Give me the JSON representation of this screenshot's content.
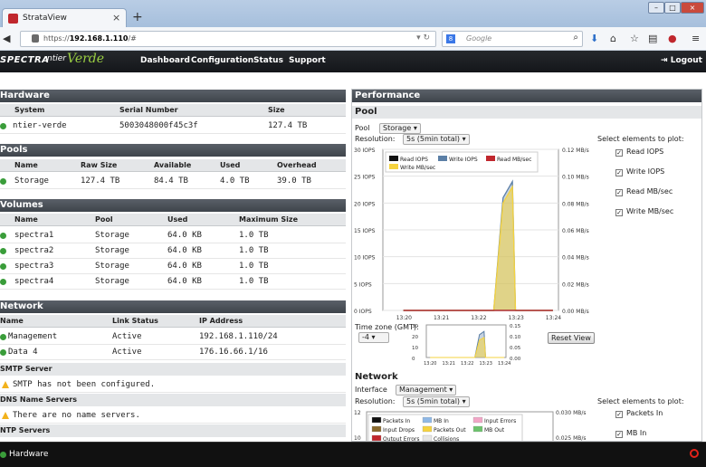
{
  "browser": {
    "tab_title": "StrataView",
    "url_prefix": "https://",
    "url_host": "192.168.1.110",
    "url_path": "/#",
    "search_placeholder": "Google"
  },
  "app": {
    "logo_text": "SPECTRA",
    "logo_sub": "ntier",
    "logo_brand": "Verde",
    "menu": [
      "Dashboard",
      "Configuration",
      "Status",
      "Support"
    ],
    "logout": "Logout"
  },
  "hardware": {
    "title": "Hardware",
    "columns": [
      "System",
      "Serial Number",
      "Size"
    ],
    "rows": [
      [
        "ntier-verde",
        "5003048000f45c3f",
        "127.4 TB"
      ]
    ]
  },
  "pools": {
    "title": "Pools",
    "columns": [
      "Name",
      "Raw Size",
      "Available",
      "Used",
      "Overhead"
    ],
    "rows": [
      [
        "Storage",
        "127.4 TB",
        "84.4 TB",
        "4.0 TB",
        "39.0 TB"
      ]
    ]
  },
  "volumes": {
    "title": "Volumes",
    "columns": [
      "Name",
      "Pool",
      "Used",
      "Maximum Size"
    ],
    "rows": [
      [
        "spectra1",
        "Storage",
        "64.0 KB",
        "1.0 TB"
      ],
      [
        "spectra2",
        "Storage",
        "64.0 KB",
        "1.0 TB"
      ],
      [
        "spectra3",
        "Storage",
        "64.0 KB",
        "1.0 TB"
      ],
      [
        "spectra4",
        "Storage",
        "64.0 KB",
        "1.0 TB"
      ]
    ]
  },
  "network": {
    "title": "Network",
    "columns": [
      "Name",
      "Link Status",
      "IP Address"
    ],
    "rows": [
      [
        "Management",
        "Active",
        "192.168.1.110/24"
      ],
      [
        "Data 4",
        "Active",
        "176.16.66.1/16"
      ]
    ],
    "smtp_header": "SMTP Server",
    "smtp_msg": "SMTP has not been configured.",
    "dns_header": "DNS Name Servers",
    "dns_msg": "There are no name servers.",
    "ntp_header": "NTP Servers"
  },
  "performance": {
    "title": "Performance",
    "pool_section": "Pool",
    "pool_label": "Pool",
    "pool_value": "Storage",
    "resolution_label": "Resolution:",
    "resolution_value": "5s (5min total)",
    "select_label": "Select elements to plot:",
    "checkboxes": [
      "Read IOPS",
      "Write IOPS",
      "Read MB/sec",
      "Write MB/sec"
    ],
    "timezone_label": "Time zone (GMT):",
    "timezone_value": "-4",
    "reset_view": "Reset View",
    "network_section": "Network",
    "interface_label": "Interface",
    "interface_value": "Management",
    "net_resolution_value": "5s (5min total)",
    "net_checkboxes": [
      "Packets In",
      "MB In"
    ]
  },
  "footer": {
    "label": "Hardware"
  },
  "chart_data": [
    {
      "type": "line",
      "y_left_ticks": [
        "30 IOPS",
        "25 IOPS",
        "20 IOPS",
        "15 IOPS",
        "10 IOPS",
        "5 IOPS",
        "0 IOPS"
      ],
      "y_right_ticks": [
        "0.12 MB/s",
        "0.10 MB/s",
        "0.08 MB/s",
        "0.06 MB/s",
        "0.04 MB/s",
        "0.02 MB/s",
        "0.00 MB/s"
      ],
      "x_ticks": [
        "13:20",
        "13:21",
        "13:22",
        "13:23",
        "13:24"
      ],
      "ylim_left": [
        0,
        30
      ],
      "legend": [
        "Read IOPS",
        "Write IOPS",
        "Read MB/sec",
        "Write MB/sec"
      ],
      "series": [
        {
          "name": "Write IOPS",
          "color": "#5b7fa6",
          "x": [
            "13:20",
            "13:21",
            "13:22",
            "13:22:25",
            "13:22:40",
            "13:22:55",
            "13:23",
            "13:24"
          ],
          "values": [
            0,
            0,
            0,
            0,
            21,
            24,
            0,
            0
          ]
        },
        {
          "name": "Write MB/sec",
          "color": "#f5d33f",
          "x": [
            "13:20",
            "13:21",
            "13:22",
            "13:22:25",
            "13:22:40",
            "13:22:55",
            "13:23",
            "13:24"
          ],
          "values": [
            0,
            0,
            0,
            0,
            0.08,
            0.092,
            0,
            0
          ]
        },
        {
          "name": "Read IOPS",
          "color": "#111111",
          "x": [
            "13:20",
            "13:24"
          ],
          "values": [
            0,
            0
          ]
        },
        {
          "name": "Read MB/sec",
          "color": "#c0272d",
          "x": [
            "13:20",
            "13:24"
          ],
          "values": [
            0,
            0
          ]
        }
      ]
    },
    {
      "type": "line",
      "y_left_ticks": [
        "30",
        "20",
        "10",
        "0"
      ],
      "y_right_ticks": [
        "0.15",
        "0.10",
        "0.05",
        "0.00"
      ],
      "x_ticks": [
        "13:20",
        "13:21",
        "13:22",
        "13:23",
        "13:24"
      ],
      "series": [
        {
          "name": "Write IOPS",
          "color": "#5b7fa6",
          "x": [
            "13:20",
            "13:22:25",
            "13:22:40",
            "13:22:55",
            "13:23",
            "13:24"
          ],
          "values": [
            0,
            0,
            21,
            24,
            0,
            0
          ]
        },
        {
          "name": "Write MB/sec",
          "color": "#f5d33f",
          "x": [
            "13:20",
            "13:22:25",
            "13:22:40",
            "13:22:55",
            "13:23",
            "13:24"
          ],
          "values": [
            0,
            0,
            0.08,
            0.092,
            0,
            0
          ]
        }
      ]
    },
    {
      "type": "line",
      "y_left_ticks": [
        "12",
        "10"
      ],
      "y_right_ticks": [
        "0.030 MB/s",
        "0.025 MB/s"
      ],
      "legend": [
        "Packets In",
        "MB In",
        "Input Errors",
        "Input Drops",
        "Packets Out",
        "MB Out",
        "Output Errors",
        "Collisions"
      ],
      "legend_colors": [
        "#111111",
        "#8fb8e6",
        "#f1a6c6",
        "#8a6a2e",
        "#f5d33f",
        "#6cc26c",
        "#c0272d",
        "#e6e6e6"
      ]
    }
  ]
}
